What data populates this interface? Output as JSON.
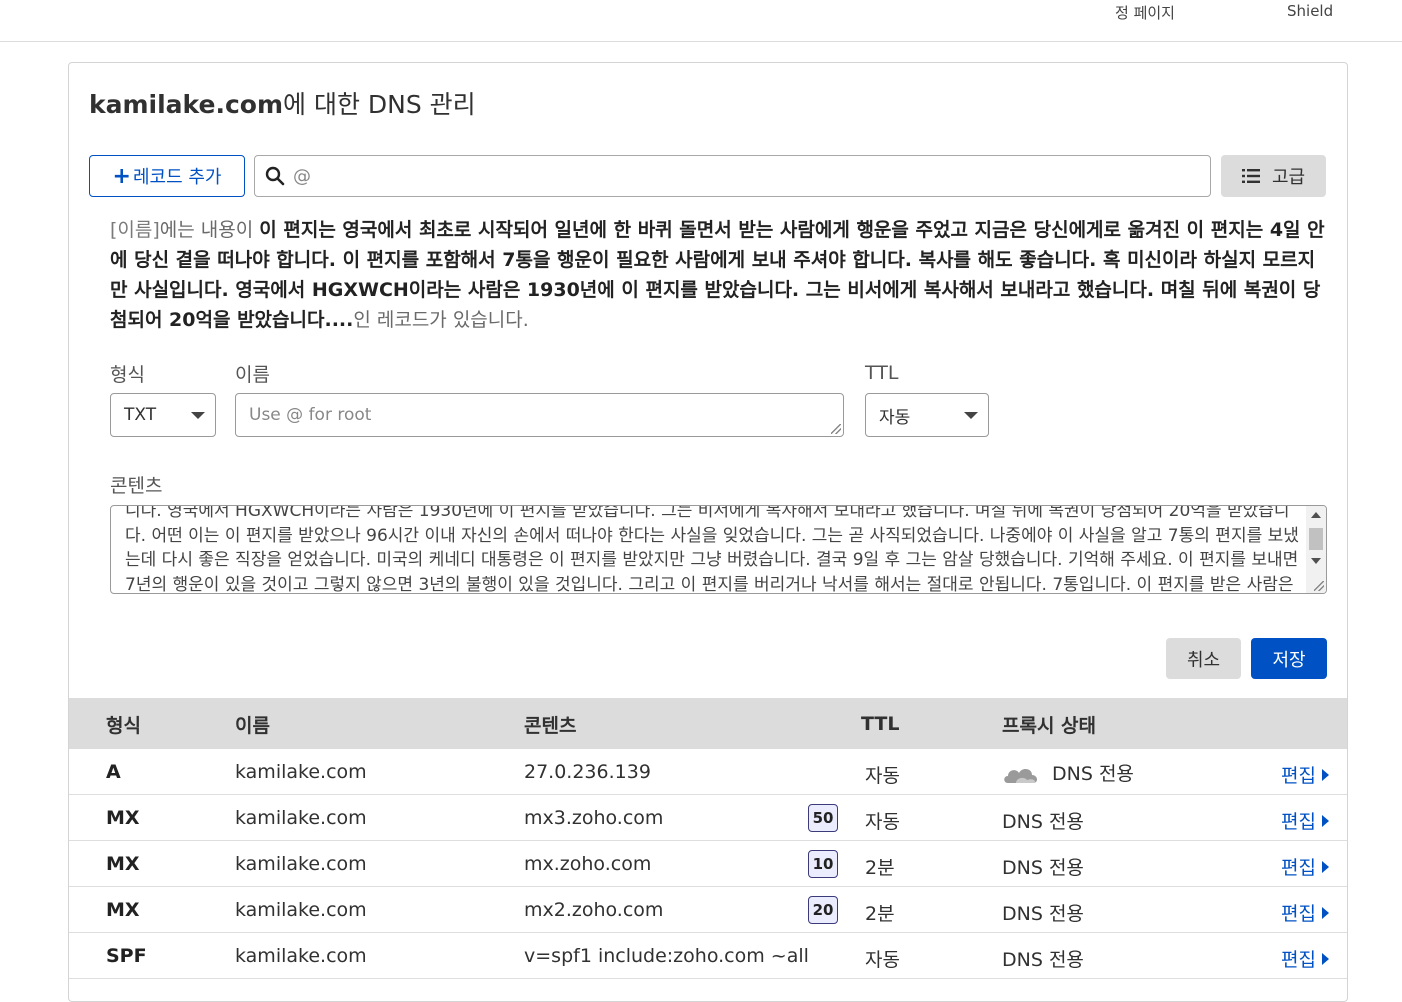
{
  "top_nav": {
    "item1": "정 페이지",
    "item2": "Shield"
  },
  "card": {
    "domain": "kamilake.com",
    "title_suffix": "에 대한 DNS 관리"
  },
  "toolbar": {
    "add_record_label": "레코드 추가",
    "search_value": "@",
    "advanced_label": "고급"
  },
  "notice": {
    "name_tag": "[이름]",
    "prefix": "에는 내용이 ",
    "content": "이 편지는 영국에서 최초로 시작되어 일년에 한 바퀴 돌면서 받는 사람에게 행운을 주었고 지금은 당신에게로 옮겨진 이 편지는 4일 안에 당신 곁을 떠나야 합니다. 이 편지를 포함해서 7통을 행운이 필요한 사람에게 보내 주셔야 합니다. 복사를 해도 좋습니다. 혹 미신이라 하실지 모르지만 사실입니다. 영국에서 HGXWCH이라는 사람은 1930년에 이 편지를 받았습니다. 그는 비서에게 복사해서 보내라고 했습니다. 며칠 뒤에 복권이 당첨되어 20억을 받았습니다....",
    "suffix": "인 레코드가 있습니다."
  },
  "form": {
    "type_label": "형식",
    "type_value": "TXT",
    "name_label": "이름",
    "name_placeholder": "Use @ for root",
    "ttl_label": "TTL",
    "ttl_value": "자동",
    "content_label": "콘텐츠",
    "content_value": "니다. 영국에서 HGXWCH이라는 사람은 1930년에 이 편지를 받았습니다. 그는 비서에게 복사해서 보내라고 했습니다. 며칠 뒤에 복권이 당첨되어 20억을 받았습니다. 어떤 이는 이 편지를 받았으나 96시간 이내 자신의 손에서 떠나야 한다는 사실을 잊었습니다. 그는 곧 사직되었습니다. 나중에야 이 사실을 알고 7통의 편지를 보냈는데 다시 좋은 직장을 얻었습니다. 미국의 케네디 대통령은 이 편지를 받았지만 그냥 버렸습니다. 결국 9일 후 그는 암살 당했습니다. 기억해 주세요. 이 편지를 보내면 7년의 행운이 있을 것이고 그렇지 않으면 3년의 불행이 있을 것입니다. 그리고 이 편지를 버리거나 낙서를 해서는 절대로 안됩니다. 7통입니다. 이 편지를 받은 사람은 행운이 깃들 것입니다.",
    "cancel_label": "취소",
    "save_label": "저장"
  },
  "table": {
    "headers": {
      "type": "형식",
      "name": "이름",
      "content": "콘텐츠",
      "ttl": "TTL",
      "proxy": "프록시 상태"
    },
    "edit_label": "편집",
    "rows": [
      {
        "type": "A",
        "name": "kamilake.com",
        "content": "27.0.236.139",
        "priority": "",
        "ttl": "자동",
        "proxy": "DNS 전용"
      },
      {
        "type": "MX",
        "name": "kamilake.com",
        "content": "mx3.zoho.com",
        "priority": "50",
        "ttl": "자동",
        "proxy": "DNS 전용"
      },
      {
        "type": "MX",
        "name": "kamilake.com",
        "content": "mx.zoho.com",
        "priority": "10",
        "ttl": "2분",
        "proxy": "DNS 전용"
      },
      {
        "type": "MX",
        "name": "kamilake.com",
        "content": "mx2.zoho.com",
        "priority": "20",
        "ttl": "2분",
        "proxy": "DNS 전용"
      },
      {
        "type": "SPF",
        "name": "kamilake.com",
        "content": "v=spf1 include:zoho.com ~all",
        "priority": "",
        "ttl": "자동",
        "proxy": "DNS 전용"
      }
    ]
  },
  "colors": {
    "accent": "#0051c3",
    "header_bg": "#dcdcdc",
    "priority_bg": "#ececff"
  }
}
